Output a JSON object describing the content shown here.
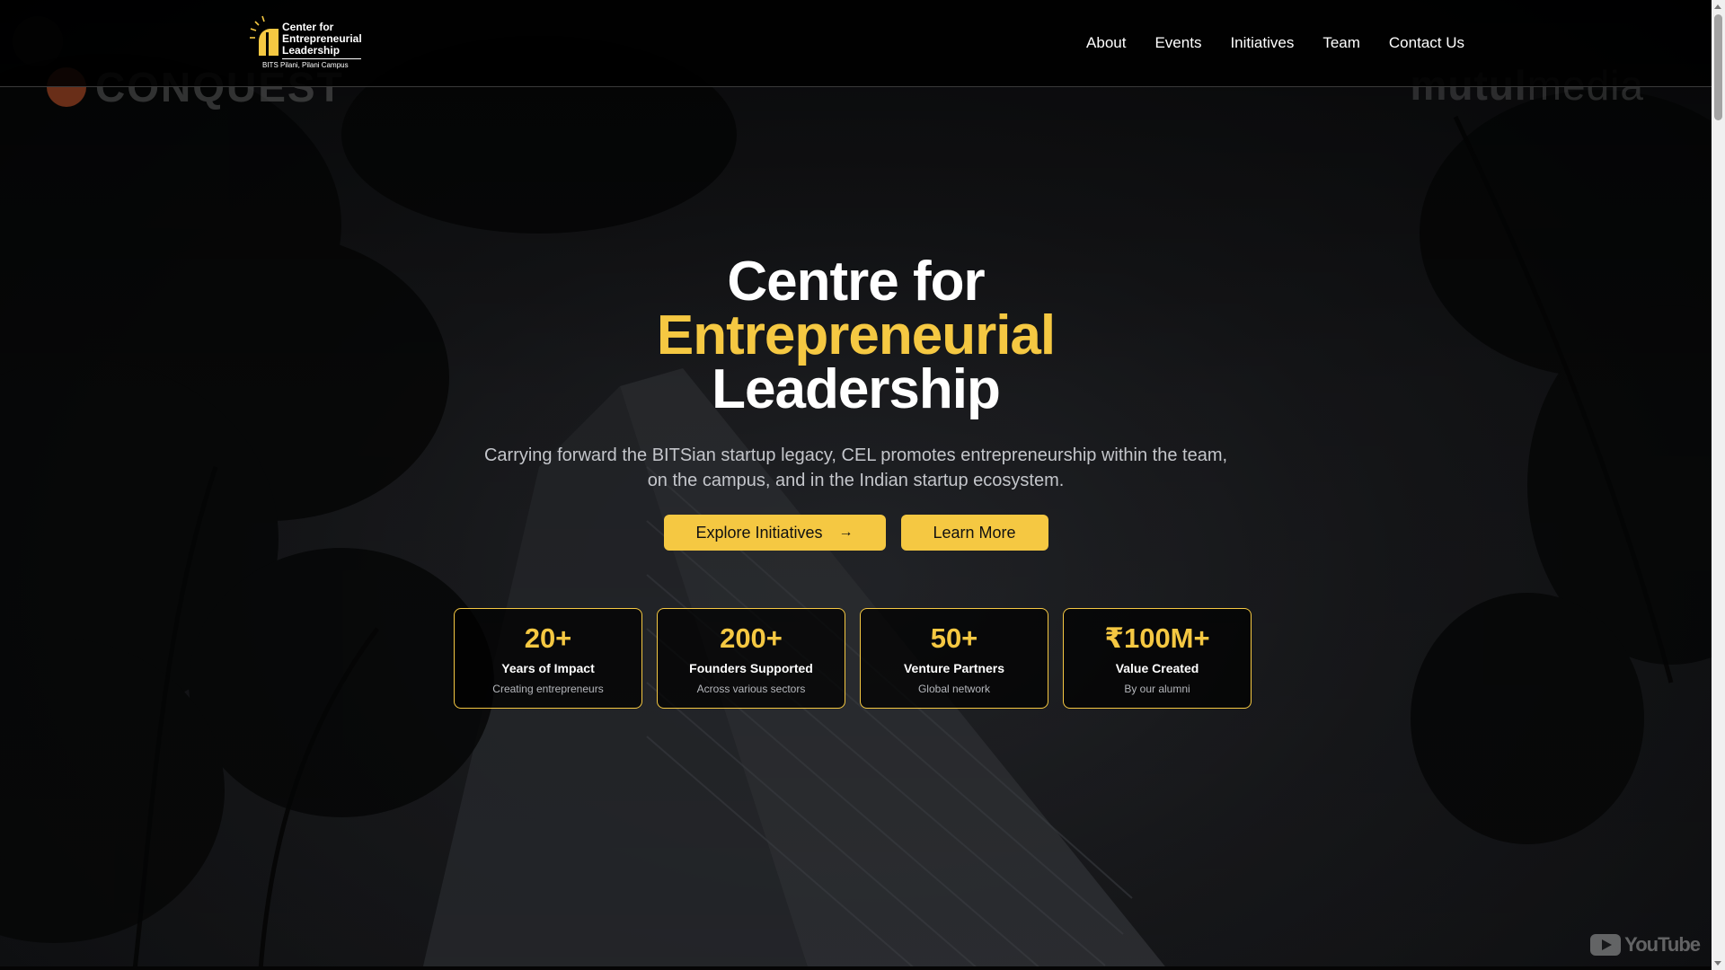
{
  "navbar": {
    "logo": {
      "title": "Center for Entrepreneurial Leadership",
      "subtitle": "BITS Pilani, Pilani Campus"
    },
    "links": [
      "About",
      "Events",
      "Initiatives",
      "Team",
      "Contact Us"
    ]
  },
  "background": {
    "left_brand": "CONQUEST",
    "right_brand_bold": "mutul",
    "right_brand_light": "media"
  },
  "hero": {
    "title_line1": "Centre for",
    "title_line2": "Entrepreneurial",
    "title_line3": "Leadership",
    "description_line1": "Carrying forward the BITSian startup legacy, CEL promotes entrepreneurship within the team,",
    "description_line2": "on the campus, and in the Indian startup ecosystem.",
    "primary_button": "Explore Initiatives",
    "secondary_button": "Learn More"
  },
  "stats": [
    {
      "value": "20+",
      "label": "Years of Impact",
      "sub": "Creating entrepreneurs"
    },
    {
      "value": "200+",
      "label": "Founders Supported",
      "sub": "Across various sectors"
    },
    {
      "value": "50+",
      "label": "Venture Partners",
      "sub": "Global network"
    },
    {
      "value": "₹100M+",
      "label": "Value Created",
      "sub": "By our alumni"
    }
  ],
  "watermark": {
    "text": "YouTube"
  },
  "colors": {
    "accent": "#f5c842",
    "navbar": "#000000",
    "text": "#ffffff"
  }
}
